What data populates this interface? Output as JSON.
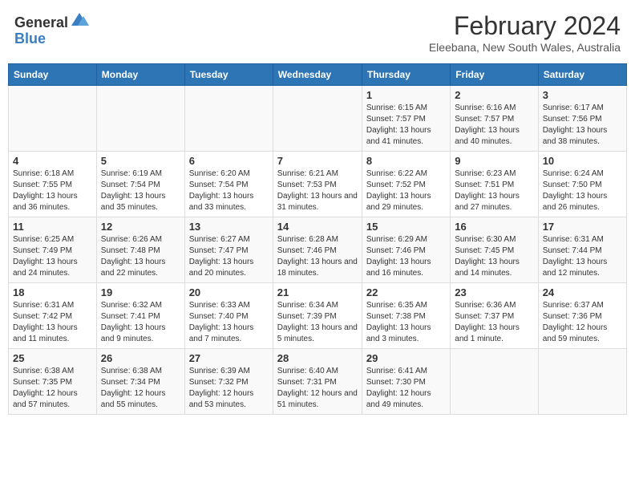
{
  "header": {
    "logo_line1": "General",
    "logo_line2": "Blue",
    "month_title": "February 2024",
    "location": "Eleebana, New South Wales, Australia"
  },
  "days_of_week": [
    "Sunday",
    "Monday",
    "Tuesday",
    "Wednesday",
    "Thursday",
    "Friday",
    "Saturday"
  ],
  "weeks": [
    [
      {
        "day": "",
        "info": ""
      },
      {
        "day": "",
        "info": ""
      },
      {
        "day": "",
        "info": ""
      },
      {
        "day": "",
        "info": ""
      },
      {
        "day": "1",
        "info": "Sunrise: 6:15 AM\nSunset: 7:57 PM\nDaylight: 13 hours and 41 minutes."
      },
      {
        "day": "2",
        "info": "Sunrise: 6:16 AM\nSunset: 7:57 PM\nDaylight: 13 hours and 40 minutes."
      },
      {
        "day": "3",
        "info": "Sunrise: 6:17 AM\nSunset: 7:56 PM\nDaylight: 13 hours and 38 minutes."
      }
    ],
    [
      {
        "day": "4",
        "info": "Sunrise: 6:18 AM\nSunset: 7:55 PM\nDaylight: 13 hours and 36 minutes."
      },
      {
        "day": "5",
        "info": "Sunrise: 6:19 AM\nSunset: 7:54 PM\nDaylight: 13 hours and 35 minutes."
      },
      {
        "day": "6",
        "info": "Sunrise: 6:20 AM\nSunset: 7:54 PM\nDaylight: 13 hours and 33 minutes."
      },
      {
        "day": "7",
        "info": "Sunrise: 6:21 AM\nSunset: 7:53 PM\nDaylight: 13 hours and 31 minutes."
      },
      {
        "day": "8",
        "info": "Sunrise: 6:22 AM\nSunset: 7:52 PM\nDaylight: 13 hours and 29 minutes."
      },
      {
        "day": "9",
        "info": "Sunrise: 6:23 AM\nSunset: 7:51 PM\nDaylight: 13 hours and 27 minutes."
      },
      {
        "day": "10",
        "info": "Sunrise: 6:24 AM\nSunset: 7:50 PM\nDaylight: 13 hours and 26 minutes."
      }
    ],
    [
      {
        "day": "11",
        "info": "Sunrise: 6:25 AM\nSunset: 7:49 PM\nDaylight: 13 hours and 24 minutes."
      },
      {
        "day": "12",
        "info": "Sunrise: 6:26 AM\nSunset: 7:48 PM\nDaylight: 13 hours and 22 minutes."
      },
      {
        "day": "13",
        "info": "Sunrise: 6:27 AM\nSunset: 7:47 PM\nDaylight: 13 hours and 20 minutes."
      },
      {
        "day": "14",
        "info": "Sunrise: 6:28 AM\nSunset: 7:46 PM\nDaylight: 13 hours and 18 minutes."
      },
      {
        "day": "15",
        "info": "Sunrise: 6:29 AM\nSunset: 7:46 PM\nDaylight: 13 hours and 16 minutes."
      },
      {
        "day": "16",
        "info": "Sunrise: 6:30 AM\nSunset: 7:45 PM\nDaylight: 13 hours and 14 minutes."
      },
      {
        "day": "17",
        "info": "Sunrise: 6:31 AM\nSunset: 7:44 PM\nDaylight: 13 hours and 12 minutes."
      }
    ],
    [
      {
        "day": "18",
        "info": "Sunrise: 6:31 AM\nSunset: 7:42 PM\nDaylight: 13 hours and 11 minutes."
      },
      {
        "day": "19",
        "info": "Sunrise: 6:32 AM\nSunset: 7:41 PM\nDaylight: 13 hours and 9 minutes."
      },
      {
        "day": "20",
        "info": "Sunrise: 6:33 AM\nSunset: 7:40 PM\nDaylight: 13 hours and 7 minutes."
      },
      {
        "day": "21",
        "info": "Sunrise: 6:34 AM\nSunset: 7:39 PM\nDaylight: 13 hours and 5 minutes."
      },
      {
        "day": "22",
        "info": "Sunrise: 6:35 AM\nSunset: 7:38 PM\nDaylight: 13 hours and 3 minutes."
      },
      {
        "day": "23",
        "info": "Sunrise: 6:36 AM\nSunset: 7:37 PM\nDaylight: 13 hours and 1 minute."
      },
      {
        "day": "24",
        "info": "Sunrise: 6:37 AM\nSunset: 7:36 PM\nDaylight: 12 hours and 59 minutes."
      }
    ],
    [
      {
        "day": "25",
        "info": "Sunrise: 6:38 AM\nSunset: 7:35 PM\nDaylight: 12 hours and 57 minutes."
      },
      {
        "day": "26",
        "info": "Sunrise: 6:38 AM\nSunset: 7:34 PM\nDaylight: 12 hours and 55 minutes."
      },
      {
        "day": "27",
        "info": "Sunrise: 6:39 AM\nSunset: 7:32 PM\nDaylight: 12 hours and 53 minutes."
      },
      {
        "day": "28",
        "info": "Sunrise: 6:40 AM\nSunset: 7:31 PM\nDaylight: 12 hours and 51 minutes."
      },
      {
        "day": "29",
        "info": "Sunrise: 6:41 AM\nSunset: 7:30 PM\nDaylight: 12 hours and 49 minutes."
      },
      {
        "day": "",
        "info": ""
      },
      {
        "day": "",
        "info": ""
      }
    ]
  ]
}
